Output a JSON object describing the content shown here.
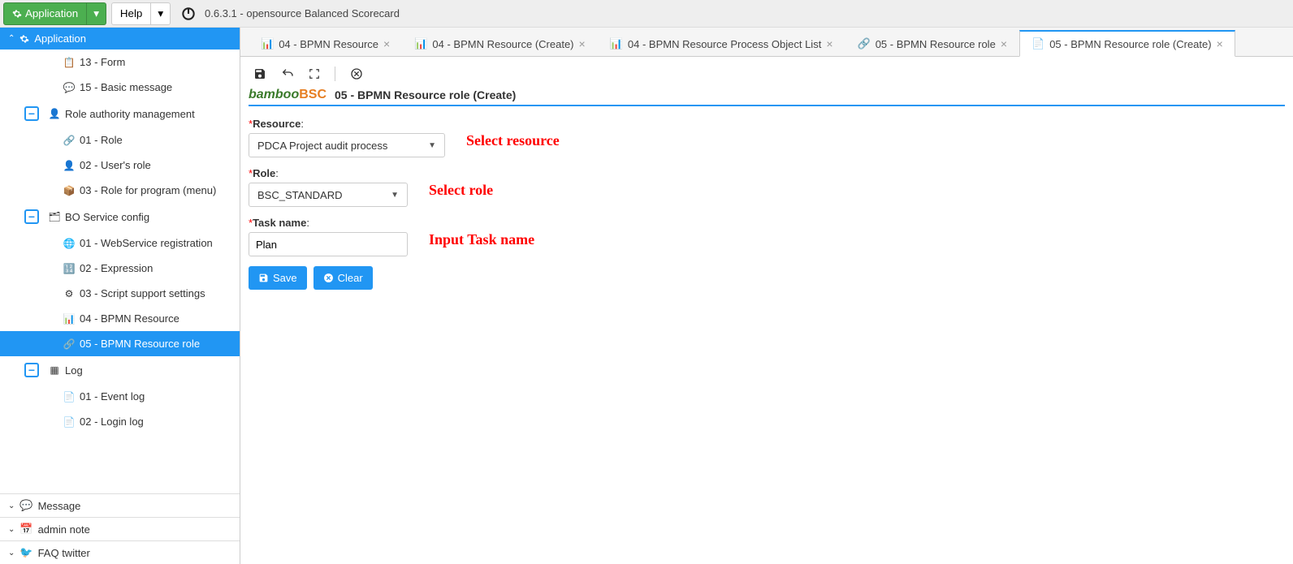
{
  "topbar": {
    "app_button": "Application",
    "help_button": "Help",
    "version_text": "0.6.3.1 - opensource Balanced Scorecard"
  },
  "sidebar": {
    "panel_title": "Application",
    "items": [
      {
        "label": "13 - Form",
        "level": "leaf",
        "icon": "form-icon"
      },
      {
        "label": "15 - Basic message",
        "level": "leaf",
        "icon": "message-icon"
      },
      {
        "label": "Role authority management",
        "level": "group",
        "icon": "user-icon"
      },
      {
        "label": "01 - Role",
        "level": "leaf",
        "icon": "share-icon"
      },
      {
        "label": "02 - User's role",
        "level": "leaf",
        "icon": "user-icon"
      },
      {
        "label": "03 - Role for program (menu)",
        "level": "leaf",
        "icon": "box-icon"
      },
      {
        "label": "BO Service config",
        "level": "group",
        "icon": "tree-icon"
      },
      {
        "label": "01 - WebService registration",
        "level": "leaf",
        "icon": "globe-icon"
      },
      {
        "label": "02 - Expression",
        "level": "leaf",
        "icon": "expr-icon"
      },
      {
        "label": "03 - Script support settings",
        "level": "leaf",
        "icon": "gear-icon"
      },
      {
        "label": "04 - BPMN Resource",
        "level": "leaf",
        "icon": "bpmn-icon"
      },
      {
        "label": "05 - BPMN Resource role",
        "level": "leaf",
        "icon": "share-icon",
        "active": true
      },
      {
        "label": "Log",
        "level": "group",
        "icon": "grid-icon"
      },
      {
        "label": "01 - Event log",
        "level": "leaf",
        "icon": "doc-icon"
      },
      {
        "label": "02 - Login log",
        "level": "leaf",
        "icon": "doc-icon"
      }
    ],
    "bottom_panels": [
      {
        "label": "Message",
        "icon": "message-icon"
      },
      {
        "label": "admin note",
        "icon": "calendar-icon"
      },
      {
        "label": "FAQ twitter",
        "icon": "twitter-icon"
      }
    ]
  },
  "tabs": [
    {
      "label": "04 - BPMN Resource",
      "icon": "bpmn-icon"
    },
    {
      "label": "04 - BPMN Resource (Create)",
      "icon": "bpmn-icon"
    },
    {
      "label": "04 - BPMN Resource Process Object List",
      "icon": "bpmn-icon"
    },
    {
      "label": "05 - BPMN Resource role",
      "icon": "share-icon"
    },
    {
      "label": "05 - BPMN Resource role (Create)",
      "icon": "doc-icon",
      "active": true
    }
  ],
  "page": {
    "logo_part1": "bamboo",
    "logo_part2": "BSC",
    "title": "05 - BPMN Resource role (Create)"
  },
  "form": {
    "resource_label": "Resource",
    "resource_value": "PDCA Project audit process",
    "resource_hint": "Select resource",
    "role_label": "Role",
    "role_value": "BSC_STANDARD",
    "role_hint": "Select role",
    "task_label": "Task name",
    "task_value": "Plan",
    "task_hint": "Input Task name",
    "save_label": "Save",
    "clear_label": "Clear"
  }
}
